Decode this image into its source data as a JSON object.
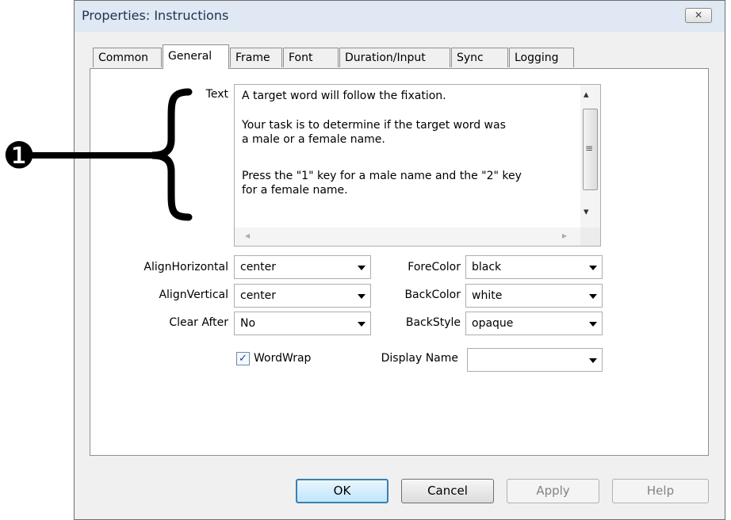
{
  "window": {
    "title": "Properties: Instructions",
    "close_glyph": "✕"
  },
  "tabs": [
    "Common",
    "General",
    "Frame",
    "Font",
    "Duration/Input",
    "Sync",
    "Logging"
  ],
  "active_tab": "General",
  "callout": {
    "number": "❶"
  },
  "text_field": {
    "label": "Text",
    "lines": [
      "A target word will follow the fixation.",
      "Your task is to determine if the target word was",
      "a male or a female name.",
      "Press the \"1\" key for a male name and the \"2\" key",
      "for a female name."
    ]
  },
  "left_fields": [
    {
      "label": "AlignHorizontal",
      "value": "center"
    },
    {
      "label": "AlignVertical",
      "value": "center"
    },
    {
      "label": "Clear After",
      "value": "No"
    }
  ],
  "right_fields": [
    {
      "label": "ForeColor",
      "value": "black"
    },
    {
      "label": "BackColor",
      "value": "white"
    },
    {
      "label": "BackStyle",
      "value": "opaque"
    }
  ],
  "wordwrap": {
    "label": "WordWrap",
    "checked": true,
    "check_glyph": "✓"
  },
  "display_name": {
    "label": "Display Name",
    "value": ""
  },
  "buttons": {
    "ok": "OK",
    "cancel": "Cancel",
    "apply": "Apply",
    "help": "Help"
  },
  "scroll_glyphs": {
    "up": "▴",
    "down": "▾",
    "left": "◂",
    "right": "▸",
    "grip": "≡"
  }
}
